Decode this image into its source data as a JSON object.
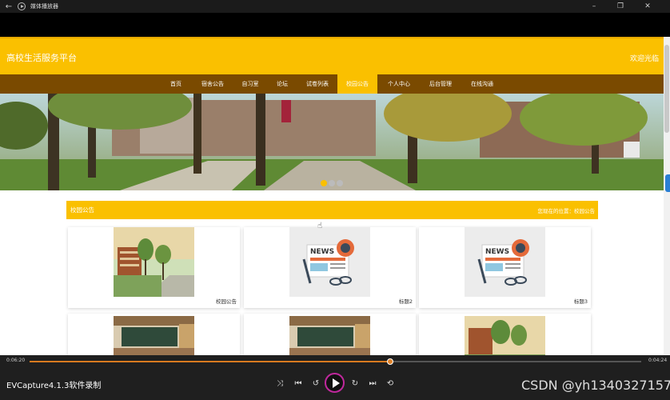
{
  "window": {
    "title": "媒体播放器"
  },
  "site": {
    "title": "高校生活服务平台",
    "welcome": "欢迎光临",
    "nav": [
      "首页",
      "宿舍公告",
      "自习室",
      "论坛",
      "试卷列表",
      "校园公告",
      "个人中心",
      "后台管理",
      "在线沟通"
    ],
    "active_nav": "校园公告"
  },
  "notice": {
    "title": "校园公告",
    "breadcrumb": "您现在的位置：校园公告"
  },
  "cards": [
    {
      "caption": "校园公告",
      "image": "campus-building"
    },
    {
      "caption": "标题2",
      "image": "news-illustration"
    },
    {
      "caption": "标题3",
      "image": "news-illustration"
    }
  ],
  "player": {
    "elapsed": "0:06:20",
    "total": "0:04:24",
    "progress": 0.59,
    "brand": "EVCapture4.1.3软件录制",
    "icons": [
      "shuffle-icon",
      "previous-icon",
      "rewind-icon",
      "play-icon",
      "forward-icon",
      "next-icon",
      "repeat-icon"
    ]
  },
  "watermark": "CSDN @yh1340327157",
  "colors": {
    "header": "#fac000",
    "nav": "#7a4a00",
    "accent": "#d87a1f",
    "play_ring": "#c0289d"
  }
}
